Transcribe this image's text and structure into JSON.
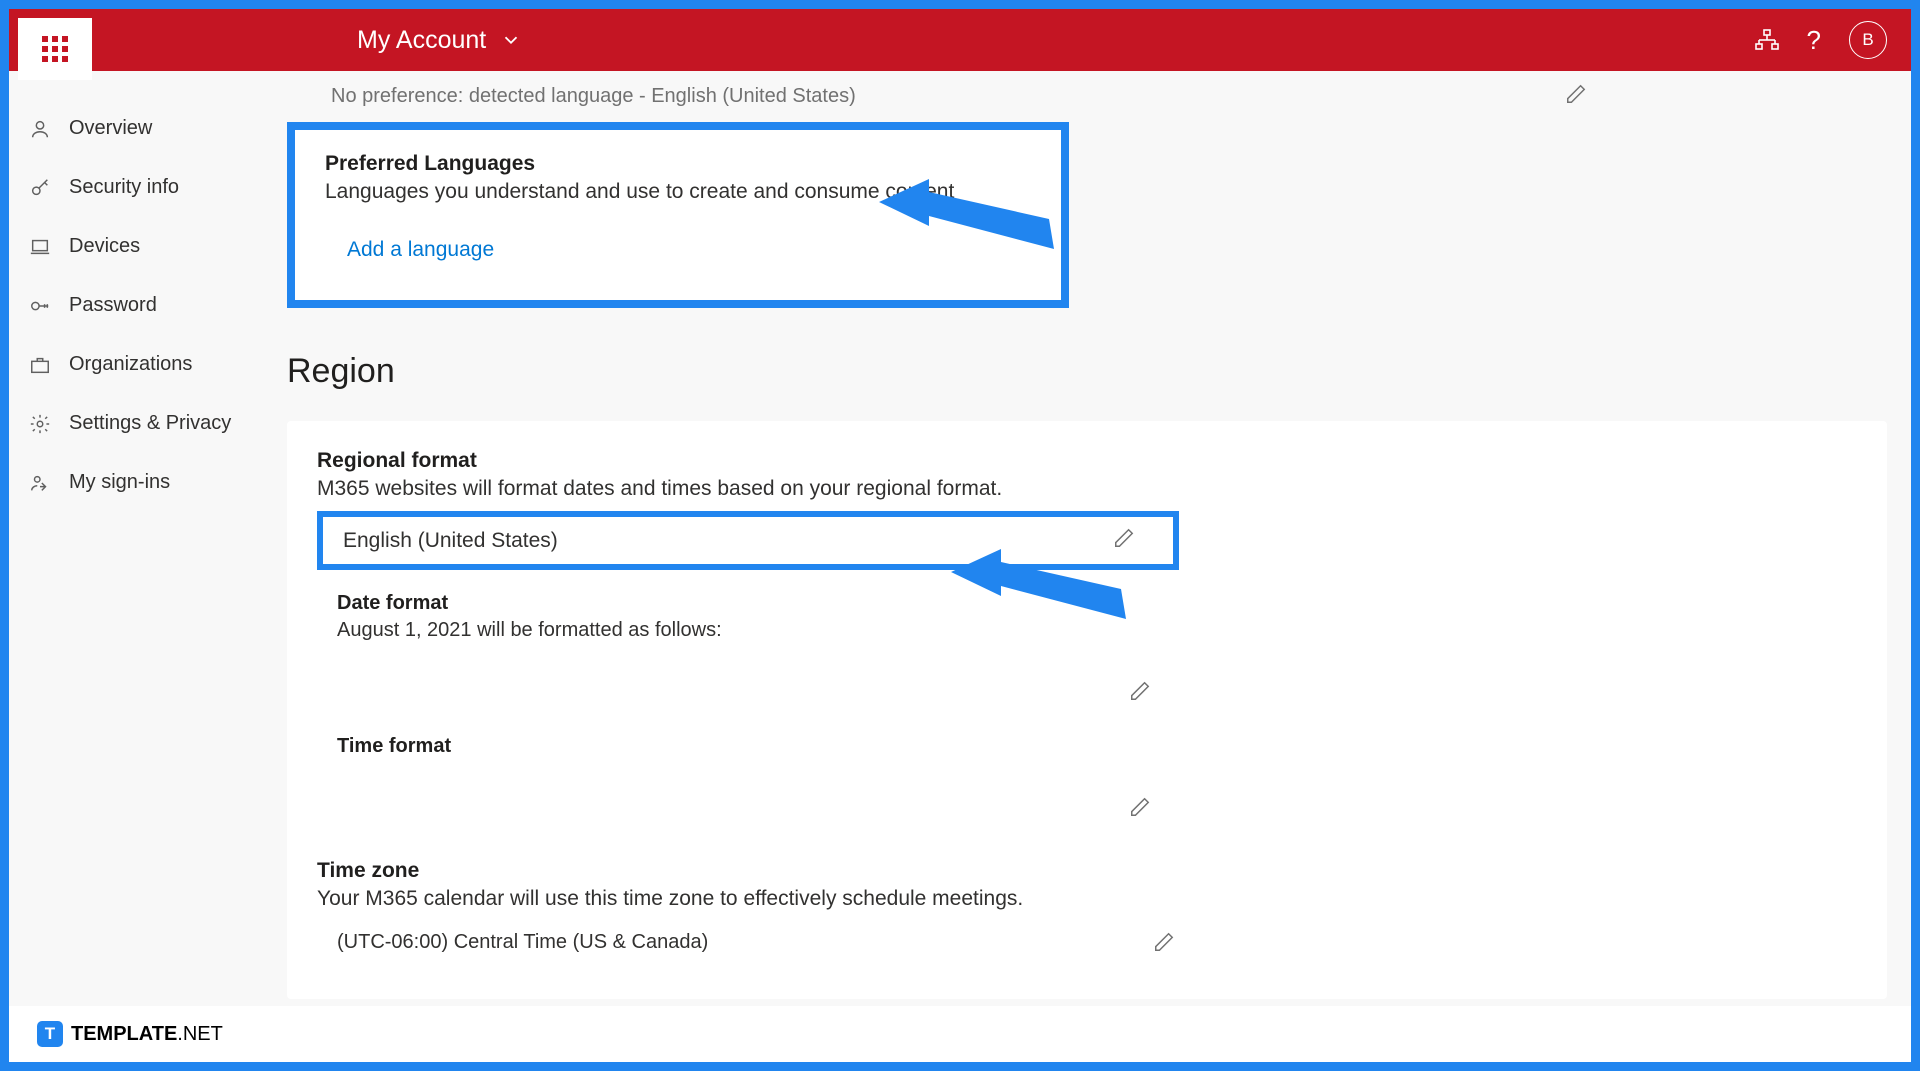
{
  "header": {
    "title": "My Account",
    "avatar_letter": "B"
  },
  "sidebar": {
    "items": [
      {
        "label": "Overview"
      },
      {
        "label": "Security info"
      },
      {
        "label": "Devices"
      },
      {
        "label": "Password"
      },
      {
        "label": "Organizations"
      },
      {
        "label": "Settings & Privacy"
      },
      {
        "label": "My sign-ins"
      }
    ]
  },
  "display_language": {
    "detected": "No preference: detected language - English (United States)"
  },
  "preferred_languages": {
    "title": "Preferred Languages",
    "description": "Languages you understand and use to create and consume content",
    "add_link": "Add a language"
  },
  "region": {
    "heading": "Region",
    "format_title": "Regional format",
    "format_desc": "M365 websites will format dates and times based on your regional format.",
    "format_value": "English (United States)",
    "date_title": "Date format",
    "date_desc": "August 1, 2021 will be formatted as follows:",
    "time_title": "Time format",
    "tz_title": "Time zone",
    "tz_desc": "Your M365 calendar will use this time zone to effectively schedule meetings.",
    "tz_value": "(UTC-06:00) Central Time (US & Canada)"
  },
  "footer": {
    "brand": "TEMPLATE",
    "suffix": ".NET"
  }
}
